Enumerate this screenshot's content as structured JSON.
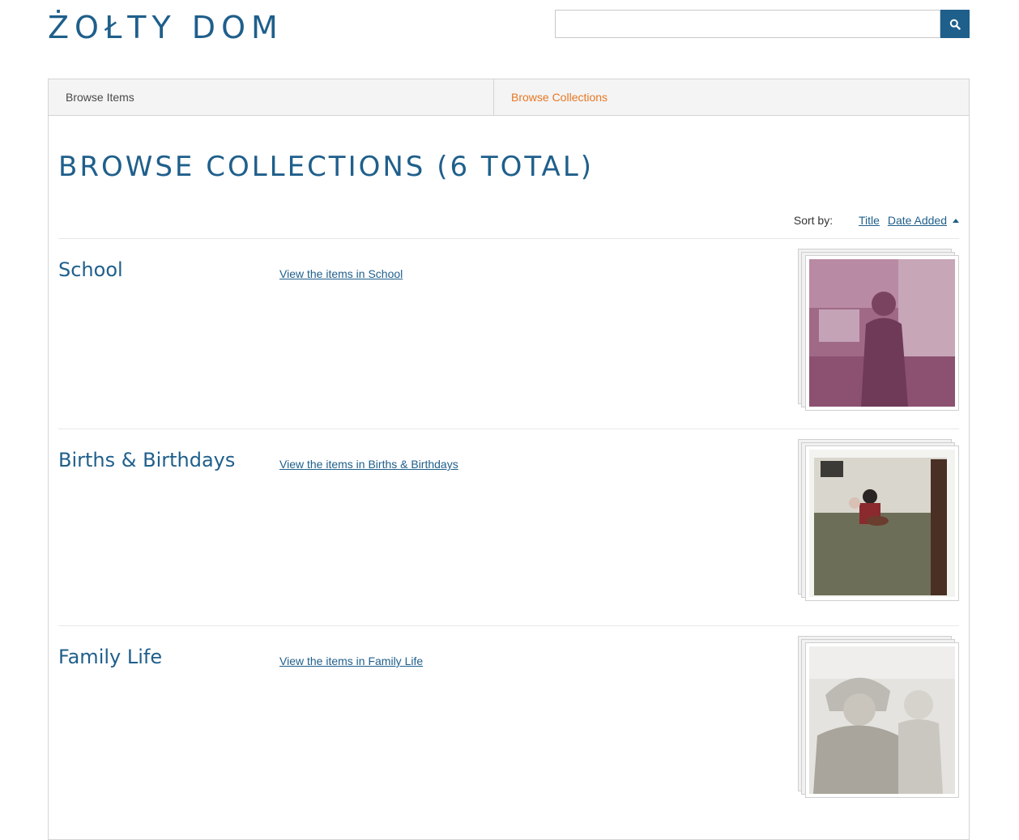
{
  "site": {
    "title": "ŻOŁTY DOM"
  },
  "search": {
    "value": "",
    "placeholder": "",
    "button_icon": "search-icon"
  },
  "nav": {
    "items": [
      {
        "label": "Browse Items",
        "active": false
      },
      {
        "label": "Browse Collections",
        "active": true
      }
    ]
  },
  "page": {
    "title": "BROWSE COLLECTIONS (6 TOTAL)"
  },
  "sort": {
    "label": "Sort by:",
    "options": [
      "Title",
      "Date Added"
    ],
    "active_direction_icon": "sort-ascending-icon"
  },
  "collections": [
    {
      "title": "School",
      "link": "View the items in School"
    },
    {
      "title": "Births & Birthdays",
      "link": "View the items in Births & Birthdays"
    },
    {
      "title": "Family Life",
      "link": "View the items in Family Life"
    }
  ],
  "colors": {
    "brand": "#1f5f8b",
    "active_nav": "#e87722",
    "nav_bg": "#f4f4f4"
  }
}
